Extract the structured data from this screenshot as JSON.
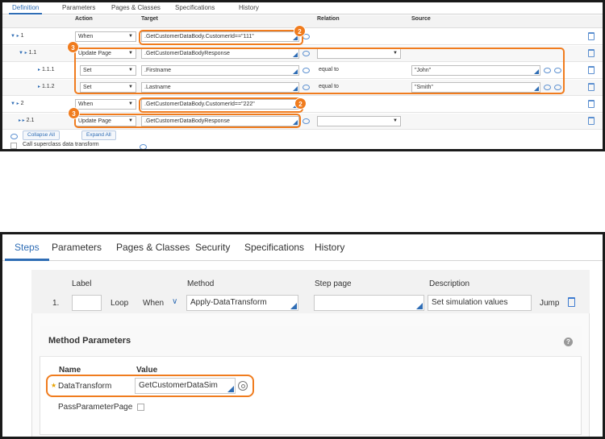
{
  "top": {
    "tabs": [
      "Definition",
      "Parameters",
      "Pages & Classes",
      "Specifications",
      "History"
    ],
    "columns": {
      "action": "Action",
      "target": "Target",
      "relation": "Relation",
      "source": "Source"
    },
    "rows": [
      {
        "id": "1",
        "action": "When",
        "target": ".GetCustomerDataBody.CustomerId==\"111\"",
        "relation": "",
        "source": ""
      },
      {
        "id": "1.1",
        "action": "Update Page",
        "target": ".GetCustomerDataBodyResponse",
        "relation": "",
        "source": ""
      },
      {
        "id": "1.1.1",
        "action": "Set",
        "target": ".Firstname",
        "relation": "equal to",
        "source": "\"John\""
      },
      {
        "id": "1.1.2",
        "action": "Set",
        "target": ".Lastname",
        "relation": "equal to",
        "source": "\"Smith\""
      },
      {
        "id": "2",
        "action": "When",
        "target": ".GetCustomerDataBody.CustomerId==\"222\"",
        "relation": "",
        "source": ""
      },
      {
        "id": "2.1",
        "action": "Update Page",
        "target": ".GetCustomerDataBodyResponse",
        "relation": "",
        "source": ""
      }
    ],
    "badges": {
      "two": "2",
      "three": "3"
    },
    "buttons": {
      "collapse_all": "Collapse All",
      "expand_all": "Expand All"
    },
    "superclass_label": "Call superclass data transform"
  },
  "bottom": {
    "tabs": [
      "Steps",
      "Parameters",
      "Pages & Classes",
      "Security",
      "Specifications",
      "History"
    ],
    "headers": {
      "label": "Label",
      "method": "Method",
      "step_page": "Step page",
      "description": "Description"
    },
    "step": {
      "number": "1.",
      "label_value": "",
      "loop": "Loop",
      "when": "When",
      "method": "Apply-DataTransform",
      "step_page": "",
      "description": "Set simulation values",
      "jump": "Jump"
    },
    "method_params": {
      "title": "Method Parameters",
      "col_name": "Name",
      "col_value": "Value",
      "required_mark": "★",
      "param1_name": "DataTransform",
      "param1_value": "GetCustomerDataSim",
      "param2_name": "PassParameterPage"
    }
  },
  "colors": {
    "accent": "#2f6db5",
    "highlight": "#f07c1e"
  }
}
